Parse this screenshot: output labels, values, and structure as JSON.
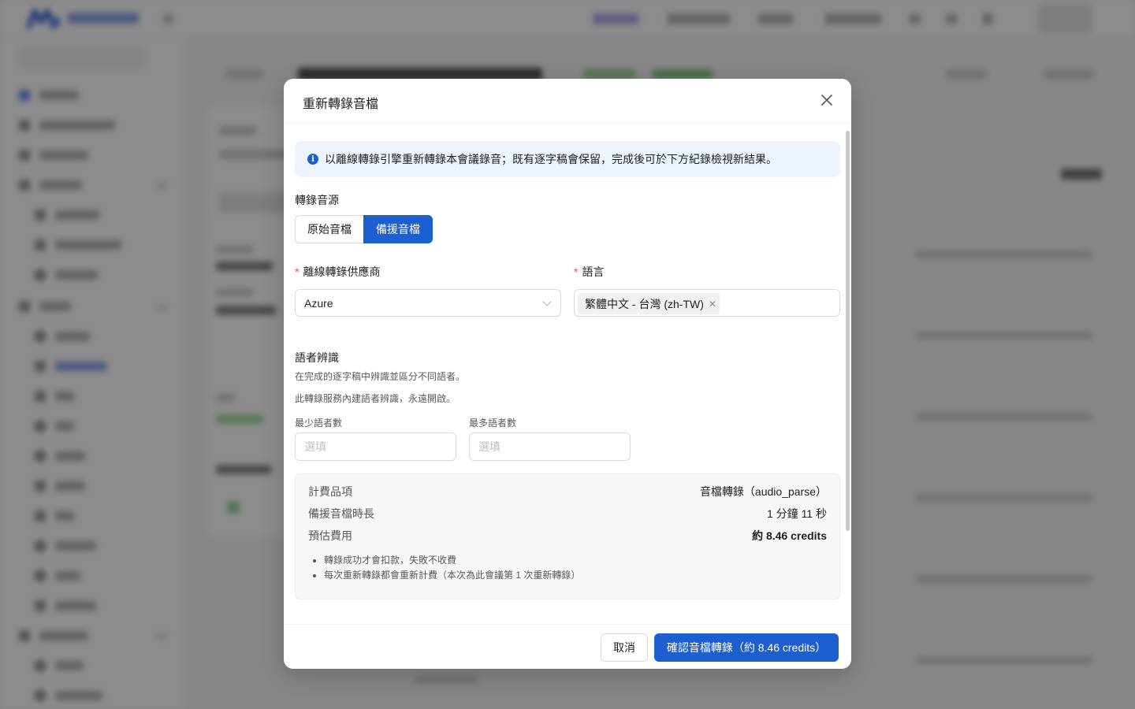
{
  "dialog": {
    "title": "重新轉錄音檔",
    "info_text": "以離線轉錄引擎重新轉錄本會議錄音；既有逐字稿會保留，完成後可於下方紀錄檢視新結果。",
    "source": {
      "label": "轉錄音源",
      "options": [
        "原始音檔",
        "備援音檔"
      ],
      "selected": "備援音檔"
    },
    "provider": {
      "label": "離線轉錄供應商",
      "value": "Azure"
    },
    "language": {
      "label": "語言",
      "tags": [
        "繁體中文 - 台灣 (zh-TW)"
      ]
    },
    "diarization": {
      "title": "語者辨識",
      "hint1": "在完成的逐字稿中辨識並區分不同語者。",
      "hint2": "此轉錄服務內建語者辨識，永遠開啟。",
      "min_label": "最少語者數",
      "max_label": "最多語者數",
      "min_placeholder": "選填",
      "max_placeholder": "選填"
    },
    "cost": {
      "rows": [
        {
          "key": "計費品項",
          "value": "音檔轉錄（audio_parse）"
        },
        {
          "key": "備援音檔時長",
          "value": "1 分鐘 11 秒"
        },
        {
          "key": "預估費用",
          "value": "約 8.46 credits"
        }
      ],
      "notes": [
        "轉錄成功才會扣款，失敗不收費",
        "每次重新轉錄都會重新計費（本次為此會議第 1 次重新轉錄）"
      ]
    },
    "footer": {
      "cancel_label": "取消",
      "confirm_label": "確認音檔轉錄（約 8.46 credits）"
    }
  },
  "colors": {
    "primary": "#1d5fd1",
    "info_bg": "#eef4ff",
    "required": "#ff4d4f"
  }
}
